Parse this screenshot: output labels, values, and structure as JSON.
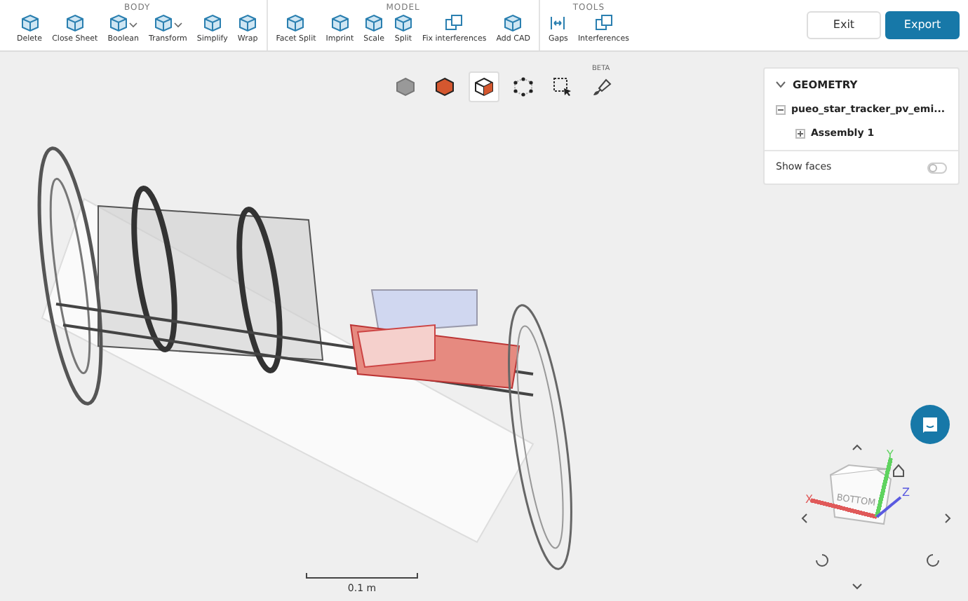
{
  "toolbar": {
    "groups": [
      {
        "label": "BODY",
        "items": [
          {
            "label": "Delete",
            "dropdown": false
          },
          {
            "label": "Close Sheet",
            "dropdown": false
          },
          {
            "label": "Boolean",
            "dropdown": true
          },
          {
            "label": "Transform",
            "dropdown": true
          },
          {
            "label": "Simplify",
            "dropdown": false
          },
          {
            "label": "Wrap",
            "dropdown": false
          }
        ]
      },
      {
        "label": "MODEL",
        "items": [
          {
            "label": "Facet Split",
            "dropdown": false
          },
          {
            "label": "Imprint",
            "dropdown": false
          },
          {
            "label": "Scale",
            "dropdown": false
          },
          {
            "label": "Split",
            "dropdown": false
          },
          {
            "label": "Fix interferences",
            "dropdown": false
          },
          {
            "label": "Add CAD",
            "dropdown": false
          }
        ]
      },
      {
        "label": "TOOLS",
        "items": [
          {
            "label": "Gaps",
            "dropdown": false
          },
          {
            "label": "Interferences",
            "dropdown": false
          }
        ]
      }
    ]
  },
  "actions": [
    {
      "label": "Exit",
      "kind": "secondary"
    },
    {
      "label": "Export",
      "kind": "primary"
    }
  ],
  "view_toolbar": [
    {
      "kind": "shaded",
      "selected": false
    },
    {
      "kind": "solid",
      "selected": false
    },
    {
      "kind": "faces",
      "selected": true
    },
    {
      "kind": "vertices",
      "selected": false
    },
    {
      "kind": "box-select",
      "selected": false
    },
    {
      "kind": "paint",
      "selected": false,
      "badge": "BETA"
    }
  ],
  "geometry_panel": {
    "title": "GEOMETRY",
    "expanded": true,
    "tree": [
      {
        "label": "pueo_star_tracker_pv_emi...",
        "expanded": true,
        "children": [
          {
            "label": "Assembly 1",
            "expanded": false
          }
        ]
      }
    ],
    "show_faces": {
      "label": "Show faces",
      "on": false
    }
  },
  "view_cube": {
    "face": "BOTTOM",
    "axes": [
      {
        "label": "X",
        "color": "#e05a5a"
      },
      {
        "label": "Y",
        "color": "#5fd35f"
      },
      {
        "label": "Z",
        "color": "#5a5ae0"
      }
    ]
  },
  "scale_bar": {
    "label": "0.1 m"
  }
}
